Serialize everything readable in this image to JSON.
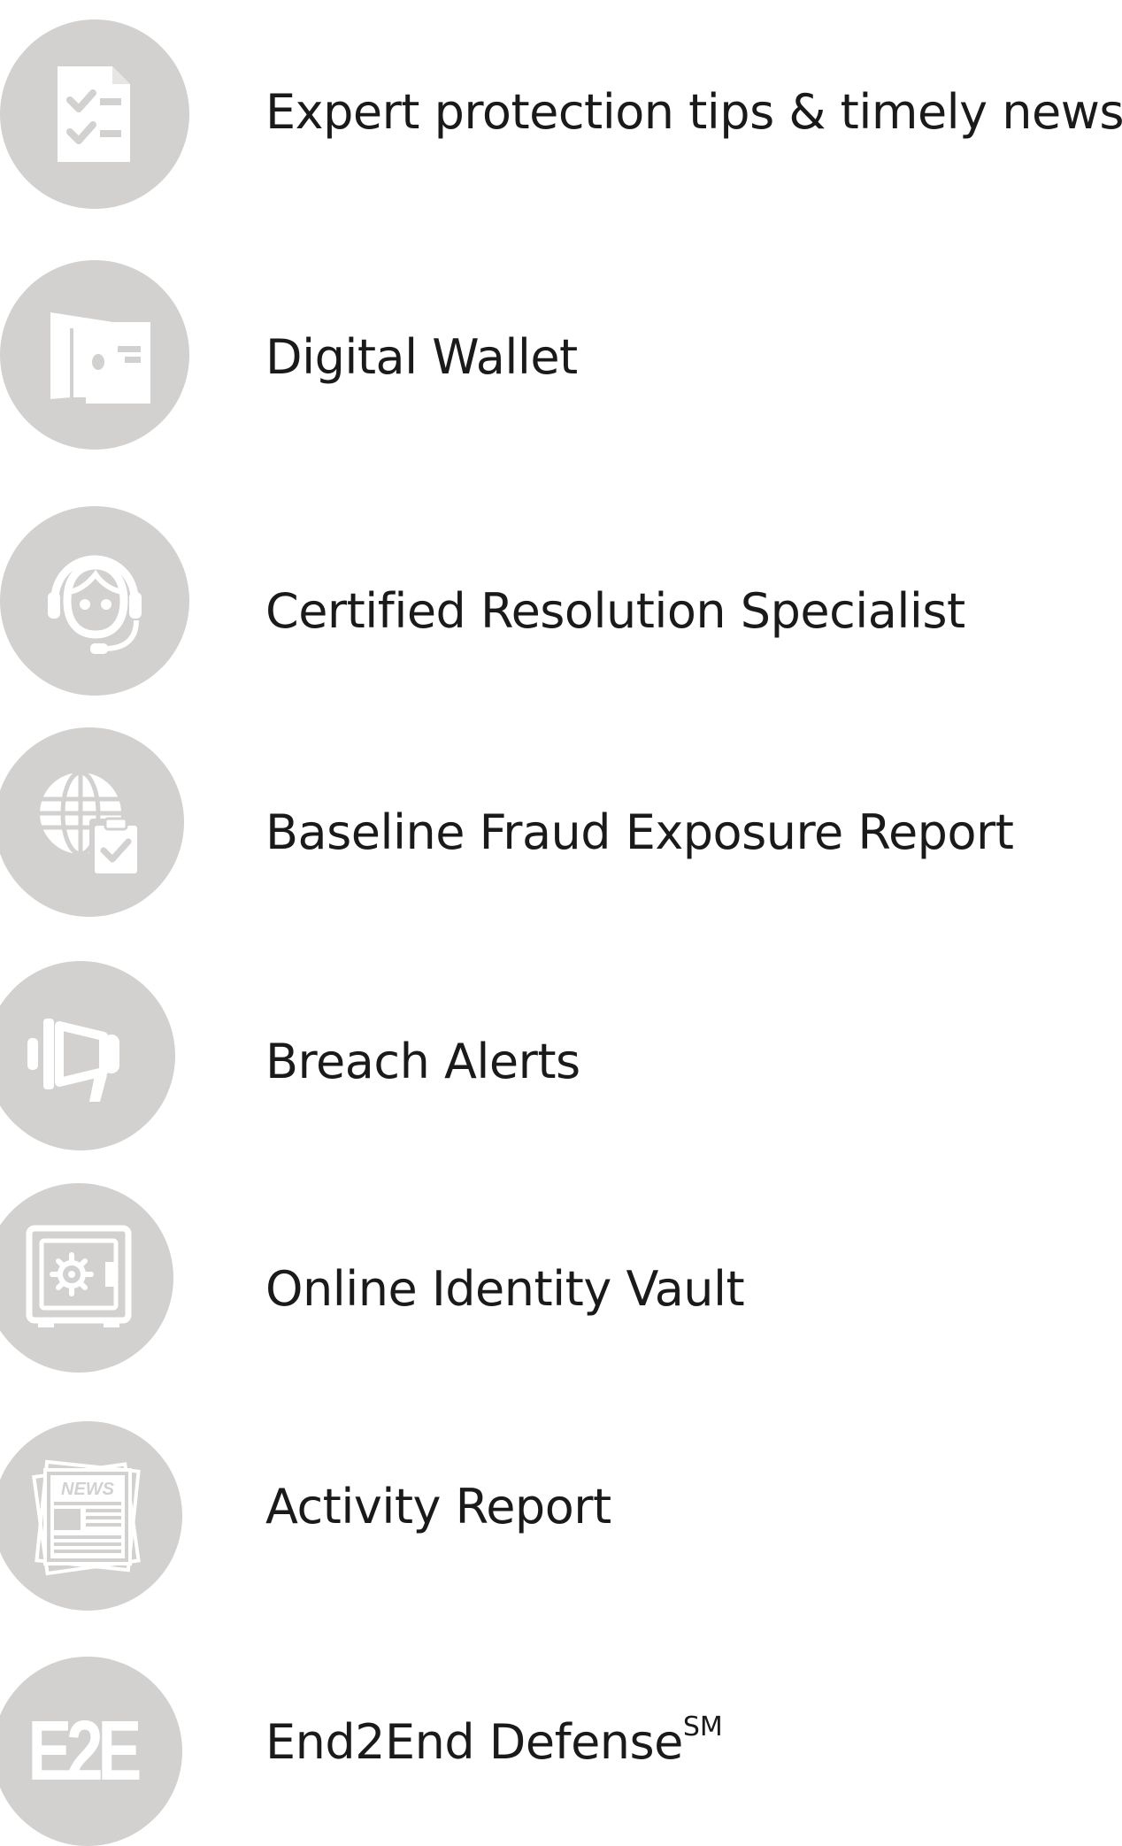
{
  "features": [
    {
      "label": "Expert protection tips & timely news",
      "icon": "checklist-icon"
    },
    {
      "label": "Digital Wallet",
      "icon": "wallet-icon"
    },
    {
      "label": "Certified Resolution Specialist",
      "icon": "headset-agent-icon"
    },
    {
      "label": "Baseline Fraud Exposure Report",
      "icon": "globe-clipboard-icon"
    },
    {
      "label": "Breach Alerts",
      "icon": "megaphone-icon"
    },
    {
      "label": "Online Identity Vault",
      "icon": "vault-safe-icon"
    },
    {
      "label": "Activity Report",
      "icon": "newspaper-icon"
    },
    {
      "label": "End2End Defense",
      "label_superscript": "SM",
      "icon": "e2e-icon",
      "icon_text": "E2E"
    }
  ],
  "colors": {
    "icon_circle": "#d3d1cf",
    "icon_glyph": "#ffffff",
    "text": "#1a1a1a"
  }
}
